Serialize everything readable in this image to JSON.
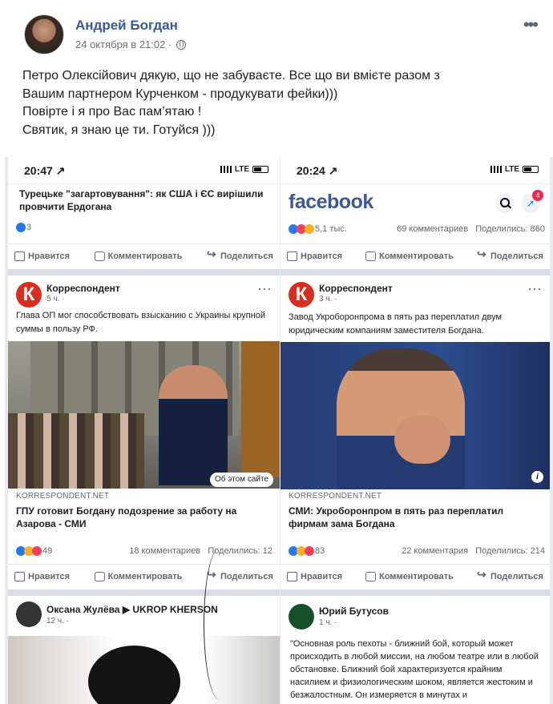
{
  "post": {
    "author": "Андрей Богдан",
    "timestamp": "24 октября в 21:02 ·",
    "text": [
      "Петро Олексійович дякую, що не забуваєте. Все що ви вмієте разом з",
      "Вашим партнером Курченком - продукувати фейки)))",
      "Повірте і я про Вас пам’ятаю !",
      "Святик, я знаю це ти. Готуйся )))"
    ],
    "more_icon": "more-icon",
    "globe_icon": "globe-icon"
  },
  "left": {
    "status": {
      "time": "20:47 ↗",
      "network": "LTE"
    },
    "top_headline": "Турецьке \"загартовування\": як США і ЄС вирішили провчити Ердогана",
    "top_stats": {
      "count": "3"
    },
    "actions": {
      "like": "Нравится",
      "comment": "Комментировать",
      "share": "Поделиться"
    },
    "post": {
      "source": "Корреспондент",
      "age": "5 ч. ·",
      "text": "Глава ОП мог способствовать взысканию с Украины крупной суммы в пользу РФ.",
      "site_chip": "Об этом сайте",
      "domain": "KORRESPONDENT.NET",
      "title": "ГПУ готовит Богдану подозрение за работу на Азарова - СМИ",
      "reaction_count": "49",
      "comments": "18 комментариев",
      "shares": "Поделились: 12"
    },
    "next": {
      "name": "Оксана Жулёва ▶ UKROP KHERSON",
      "age": "12 ч. ·"
    }
  },
  "right": {
    "status": {
      "time": "20:24 ↗",
      "network": "LTE"
    },
    "brand": "facebook",
    "messenger_badge": "4",
    "top_stats": {
      "count": "5,1 тыс.",
      "comments": "69 комментариев",
      "shares": "Поделились: 860"
    },
    "actions": {
      "like": "Нравится",
      "comment": "Комментировать",
      "share": "Поделиться"
    },
    "post": {
      "source": "Корреспондент",
      "age": "3 ч. ·",
      "text": "Завод Укроборонпрома в пять раз переплатил двум юридическим компаниям заместителя Богдана.",
      "domain": "KORRESPONDENT.NET",
      "title": "СМИ: Укроборонпром в пять раз переплатил фирмам зама Богдана",
      "reaction_count": "83",
      "comments": "22 комментария",
      "shares": "Поделились: 214"
    },
    "next": {
      "name": "Юрий Бутусов",
      "age": "1 ч. ·",
      "quote": "\"Основная роль пехоты - ближний бой, который может происходить в любой миссии, на любом театре или в любой обстановке. Ближний бой характеризуется крайним насилием и физиологическим шоком, является жестоким и безжалостным. Он измеряется в минутах и"
    }
  },
  "colors": {
    "facebook_blue": "#385898",
    "like": "#2078f4",
    "wow": "#f7b125",
    "love": "#f33e58"
  }
}
